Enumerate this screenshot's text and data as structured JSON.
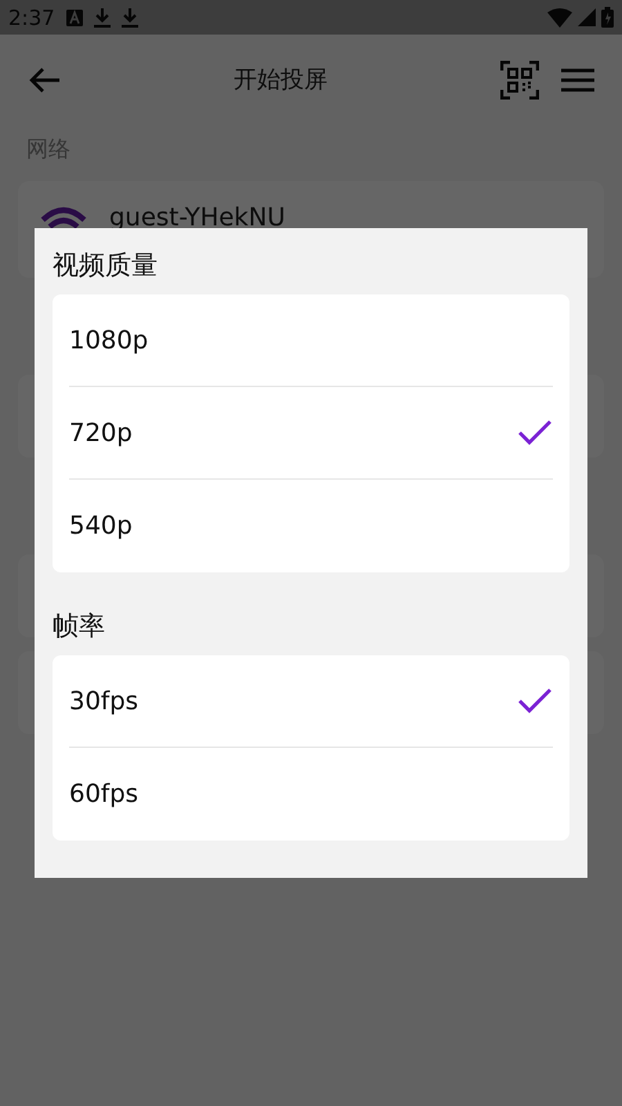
{
  "status_bar": {
    "time": "2:37"
  },
  "app_bar": {
    "title": "开始投屏"
  },
  "network": {
    "heading": "网络",
    "name": "guest-YHekNU"
  },
  "dialog": {
    "sections": [
      {
        "title": "视频质量",
        "options": [
          {
            "label": "1080p",
            "selected": false
          },
          {
            "label": "720p",
            "selected": true
          },
          {
            "label": "540p",
            "selected": false
          }
        ]
      },
      {
        "title": "帧率",
        "options": [
          {
            "label": "30fps",
            "selected": true
          },
          {
            "label": "60fps",
            "selected": false
          }
        ]
      }
    ]
  }
}
